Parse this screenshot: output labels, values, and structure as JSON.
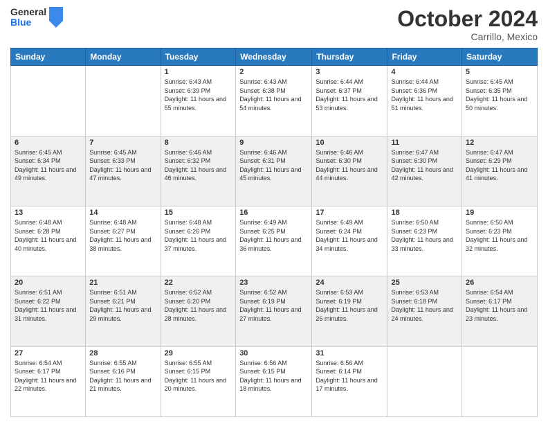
{
  "header": {
    "logo_general": "General",
    "logo_blue": "Blue",
    "month_title": "October 2024",
    "subtitle": "Carrillo, Mexico"
  },
  "days_of_week": [
    "Sunday",
    "Monday",
    "Tuesday",
    "Wednesday",
    "Thursday",
    "Friday",
    "Saturday"
  ],
  "weeks": [
    [
      {
        "day": "",
        "sunrise": "",
        "sunset": "",
        "daylight": ""
      },
      {
        "day": "",
        "sunrise": "",
        "sunset": "",
        "daylight": ""
      },
      {
        "day": "1",
        "sunrise": "Sunrise: 6:43 AM",
        "sunset": "Sunset: 6:39 PM",
        "daylight": "Daylight: 11 hours and 55 minutes."
      },
      {
        "day": "2",
        "sunrise": "Sunrise: 6:43 AM",
        "sunset": "Sunset: 6:38 PM",
        "daylight": "Daylight: 11 hours and 54 minutes."
      },
      {
        "day": "3",
        "sunrise": "Sunrise: 6:44 AM",
        "sunset": "Sunset: 6:37 PM",
        "daylight": "Daylight: 11 hours and 53 minutes."
      },
      {
        "day": "4",
        "sunrise": "Sunrise: 6:44 AM",
        "sunset": "Sunset: 6:36 PM",
        "daylight": "Daylight: 11 hours and 51 minutes."
      },
      {
        "day": "5",
        "sunrise": "Sunrise: 6:45 AM",
        "sunset": "Sunset: 6:35 PM",
        "daylight": "Daylight: 11 hours and 50 minutes."
      }
    ],
    [
      {
        "day": "6",
        "sunrise": "Sunrise: 6:45 AM",
        "sunset": "Sunset: 6:34 PM",
        "daylight": "Daylight: 11 hours and 49 minutes."
      },
      {
        "day": "7",
        "sunrise": "Sunrise: 6:45 AM",
        "sunset": "Sunset: 6:33 PM",
        "daylight": "Daylight: 11 hours and 47 minutes."
      },
      {
        "day": "8",
        "sunrise": "Sunrise: 6:46 AM",
        "sunset": "Sunset: 6:32 PM",
        "daylight": "Daylight: 11 hours and 46 minutes."
      },
      {
        "day": "9",
        "sunrise": "Sunrise: 6:46 AM",
        "sunset": "Sunset: 6:31 PM",
        "daylight": "Daylight: 11 hours and 45 minutes."
      },
      {
        "day": "10",
        "sunrise": "Sunrise: 6:46 AM",
        "sunset": "Sunset: 6:30 PM",
        "daylight": "Daylight: 11 hours and 44 minutes."
      },
      {
        "day": "11",
        "sunrise": "Sunrise: 6:47 AM",
        "sunset": "Sunset: 6:30 PM",
        "daylight": "Daylight: 11 hours and 42 minutes."
      },
      {
        "day": "12",
        "sunrise": "Sunrise: 6:47 AM",
        "sunset": "Sunset: 6:29 PM",
        "daylight": "Daylight: 11 hours and 41 minutes."
      }
    ],
    [
      {
        "day": "13",
        "sunrise": "Sunrise: 6:48 AM",
        "sunset": "Sunset: 6:28 PM",
        "daylight": "Daylight: 11 hours and 40 minutes."
      },
      {
        "day": "14",
        "sunrise": "Sunrise: 6:48 AM",
        "sunset": "Sunset: 6:27 PM",
        "daylight": "Daylight: 11 hours and 38 minutes."
      },
      {
        "day": "15",
        "sunrise": "Sunrise: 6:48 AM",
        "sunset": "Sunset: 6:26 PM",
        "daylight": "Daylight: 11 hours and 37 minutes."
      },
      {
        "day": "16",
        "sunrise": "Sunrise: 6:49 AM",
        "sunset": "Sunset: 6:25 PM",
        "daylight": "Daylight: 11 hours and 36 minutes."
      },
      {
        "day": "17",
        "sunrise": "Sunrise: 6:49 AM",
        "sunset": "Sunset: 6:24 PM",
        "daylight": "Daylight: 11 hours and 34 minutes."
      },
      {
        "day": "18",
        "sunrise": "Sunrise: 6:50 AM",
        "sunset": "Sunset: 6:23 PM",
        "daylight": "Daylight: 11 hours and 33 minutes."
      },
      {
        "day": "19",
        "sunrise": "Sunrise: 6:50 AM",
        "sunset": "Sunset: 6:23 PM",
        "daylight": "Daylight: 11 hours and 32 minutes."
      }
    ],
    [
      {
        "day": "20",
        "sunrise": "Sunrise: 6:51 AM",
        "sunset": "Sunset: 6:22 PM",
        "daylight": "Daylight: 11 hours and 31 minutes."
      },
      {
        "day": "21",
        "sunrise": "Sunrise: 6:51 AM",
        "sunset": "Sunset: 6:21 PM",
        "daylight": "Daylight: 11 hours and 29 minutes."
      },
      {
        "day": "22",
        "sunrise": "Sunrise: 6:52 AM",
        "sunset": "Sunset: 6:20 PM",
        "daylight": "Daylight: 11 hours and 28 minutes."
      },
      {
        "day": "23",
        "sunrise": "Sunrise: 6:52 AM",
        "sunset": "Sunset: 6:19 PM",
        "daylight": "Daylight: 11 hours and 27 minutes."
      },
      {
        "day": "24",
        "sunrise": "Sunrise: 6:53 AM",
        "sunset": "Sunset: 6:19 PM",
        "daylight": "Daylight: 11 hours and 26 minutes."
      },
      {
        "day": "25",
        "sunrise": "Sunrise: 6:53 AM",
        "sunset": "Sunset: 6:18 PM",
        "daylight": "Daylight: 11 hours and 24 minutes."
      },
      {
        "day": "26",
        "sunrise": "Sunrise: 6:54 AM",
        "sunset": "Sunset: 6:17 PM",
        "daylight": "Daylight: 11 hours and 23 minutes."
      }
    ],
    [
      {
        "day": "27",
        "sunrise": "Sunrise: 6:54 AM",
        "sunset": "Sunset: 6:17 PM",
        "daylight": "Daylight: 11 hours and 22 minutes."
      },
      {
        "day": "28",
        "sunrise": "Sunrise: 6:55 AM",
        "sunset": "Sunset: 6:16 PM",
        "daylight": "Daylight: 11 hours and 21 minutes."
      },
      {
        "day": "29",
        "sunrise": "Sunrise: 6:55 AM",
        "sunset": "Sunset: 6:15 PM",
        "daylight": "Daylight: 11 hours and 20 minutes."
      },
      {
        "day": "30",
        "sunrise": "Sunrise: 6:56 AM",
        "sunset": "Sunset: 6:15 PM",
        "daylight": "Daylight: 11 hours and 18 minutes."
      },
      {
        "day": "31",
        "sunrise": "Sunrise: 6:56 AM",
        "sunset": "Sunset: 6:14 PM",
        "daylight": "Daylight: 11 hours and 17 minutes."
      },
      {
        "day": "",
        "sunrise": "",
        "sunset": "",
        "daylight": ""
      },
      {
        "day": "",
        "sunrise": "",
        "sunset": "",
        "daylight": ""
      }
    ]
  ]
}
